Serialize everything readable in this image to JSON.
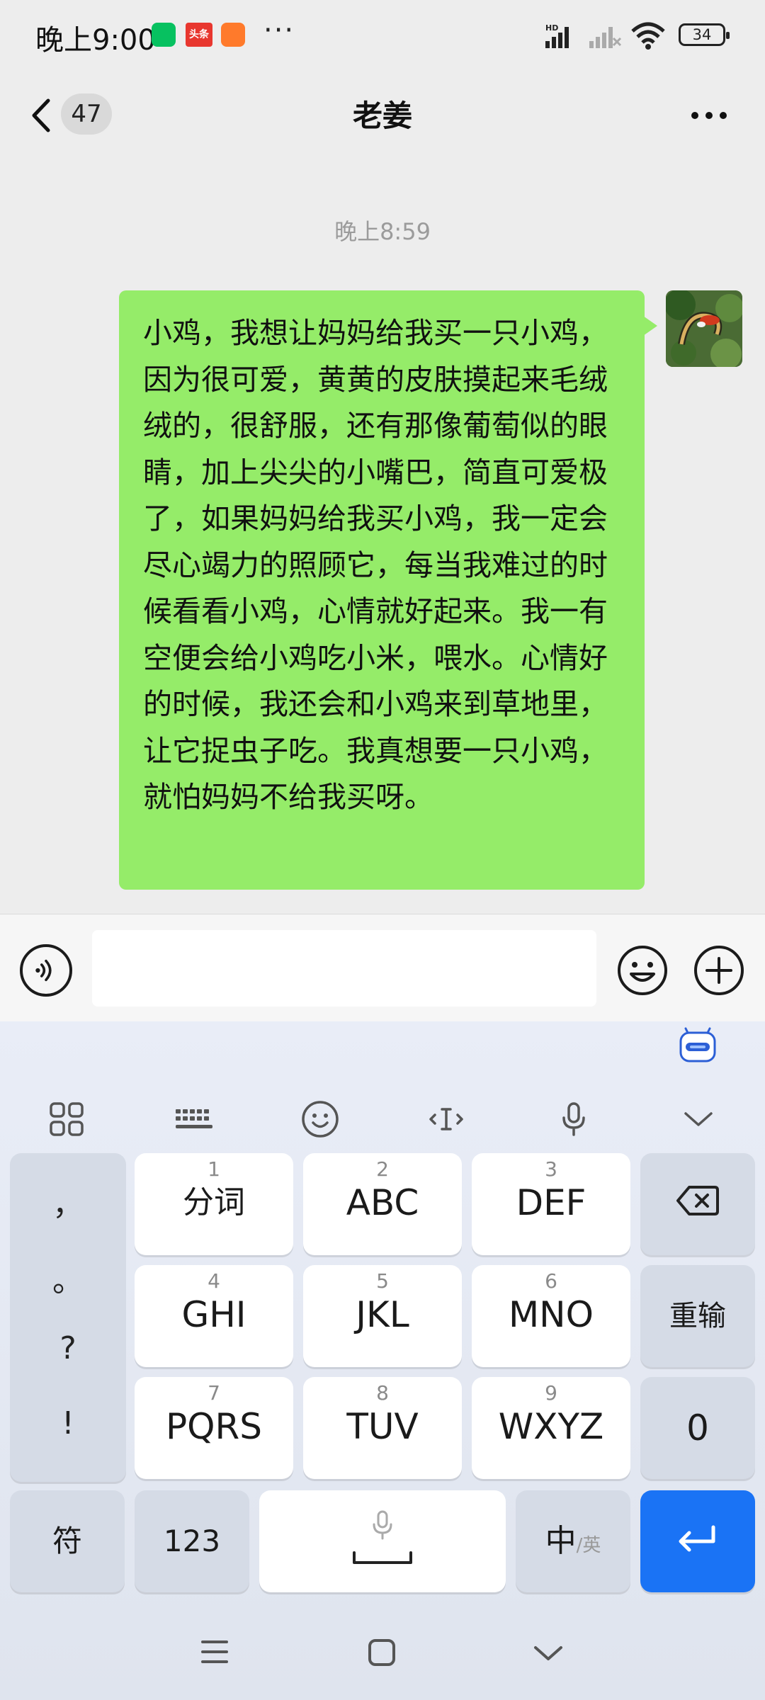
{
  "status_bar": {
    "time": "晚上9:00",
    "toutiao_label": "头条",
    "dots": "···",
    "battery": "34"
  },
  "header": {
    "unread_count": "47",
    "title": "老姜"
  },
  "chat": {
    "timestamp": "晚上8:59",
    "message": "小鸡，我想让妈妈给我买一只小鸡，因为很可爱，黄黄的皮肤摸起来毛绒绒的，很舒服，还有那像葡萄似的眼睛，加上尖尖的小嘴巴，简直可爱极了，如果妈妈给我买小鸡，我一定会尽心竭力的照顾它，每当我难过的时候看看小鸡，心情就好起来。我一有空便会给小鸡吃小米，喂水。心情好的时候，我还会和小鸡来到草地里，让它捉虫子吃。我真想要一只小鸡，就怕妈妈不给我买呀。",
    "bubble_color": "#95ec69"
  },
  "input": {
    "value": ""
  },
  "keyboard": {
    "keys": [
      {
        "num": "1",
        "label": "分词"
      },
      {
        "num": "2",
        "label": "ABC"
      },
      {
        "num": "3",
        "label": "DEF"
      },
      {
        "num": "4",
        "label": "GHI"
      },
      {
        "num": "5",
        "label": "JKL"
      },
      {
        "num": "6",
        "label": "MNO"
      },
      {
        "num": "7",
        "label": "PQRS"
      },
      {
        "num": "8",
        "label": "TUV"
      },
      {
        "num": "9",
        "label": "WXYZ"
      }
    ],
    "punctuation": [
      "，",
      "。",
      "?",
      "!"
    ],
    "reinput": "重输",
    "zero": "0",
    "symbols": "符",
    "num_mode": "123",
    "lang_main": "中",
    "lang_alt": "/英",
    "accent_color": "#1a73f5"
  }
}
